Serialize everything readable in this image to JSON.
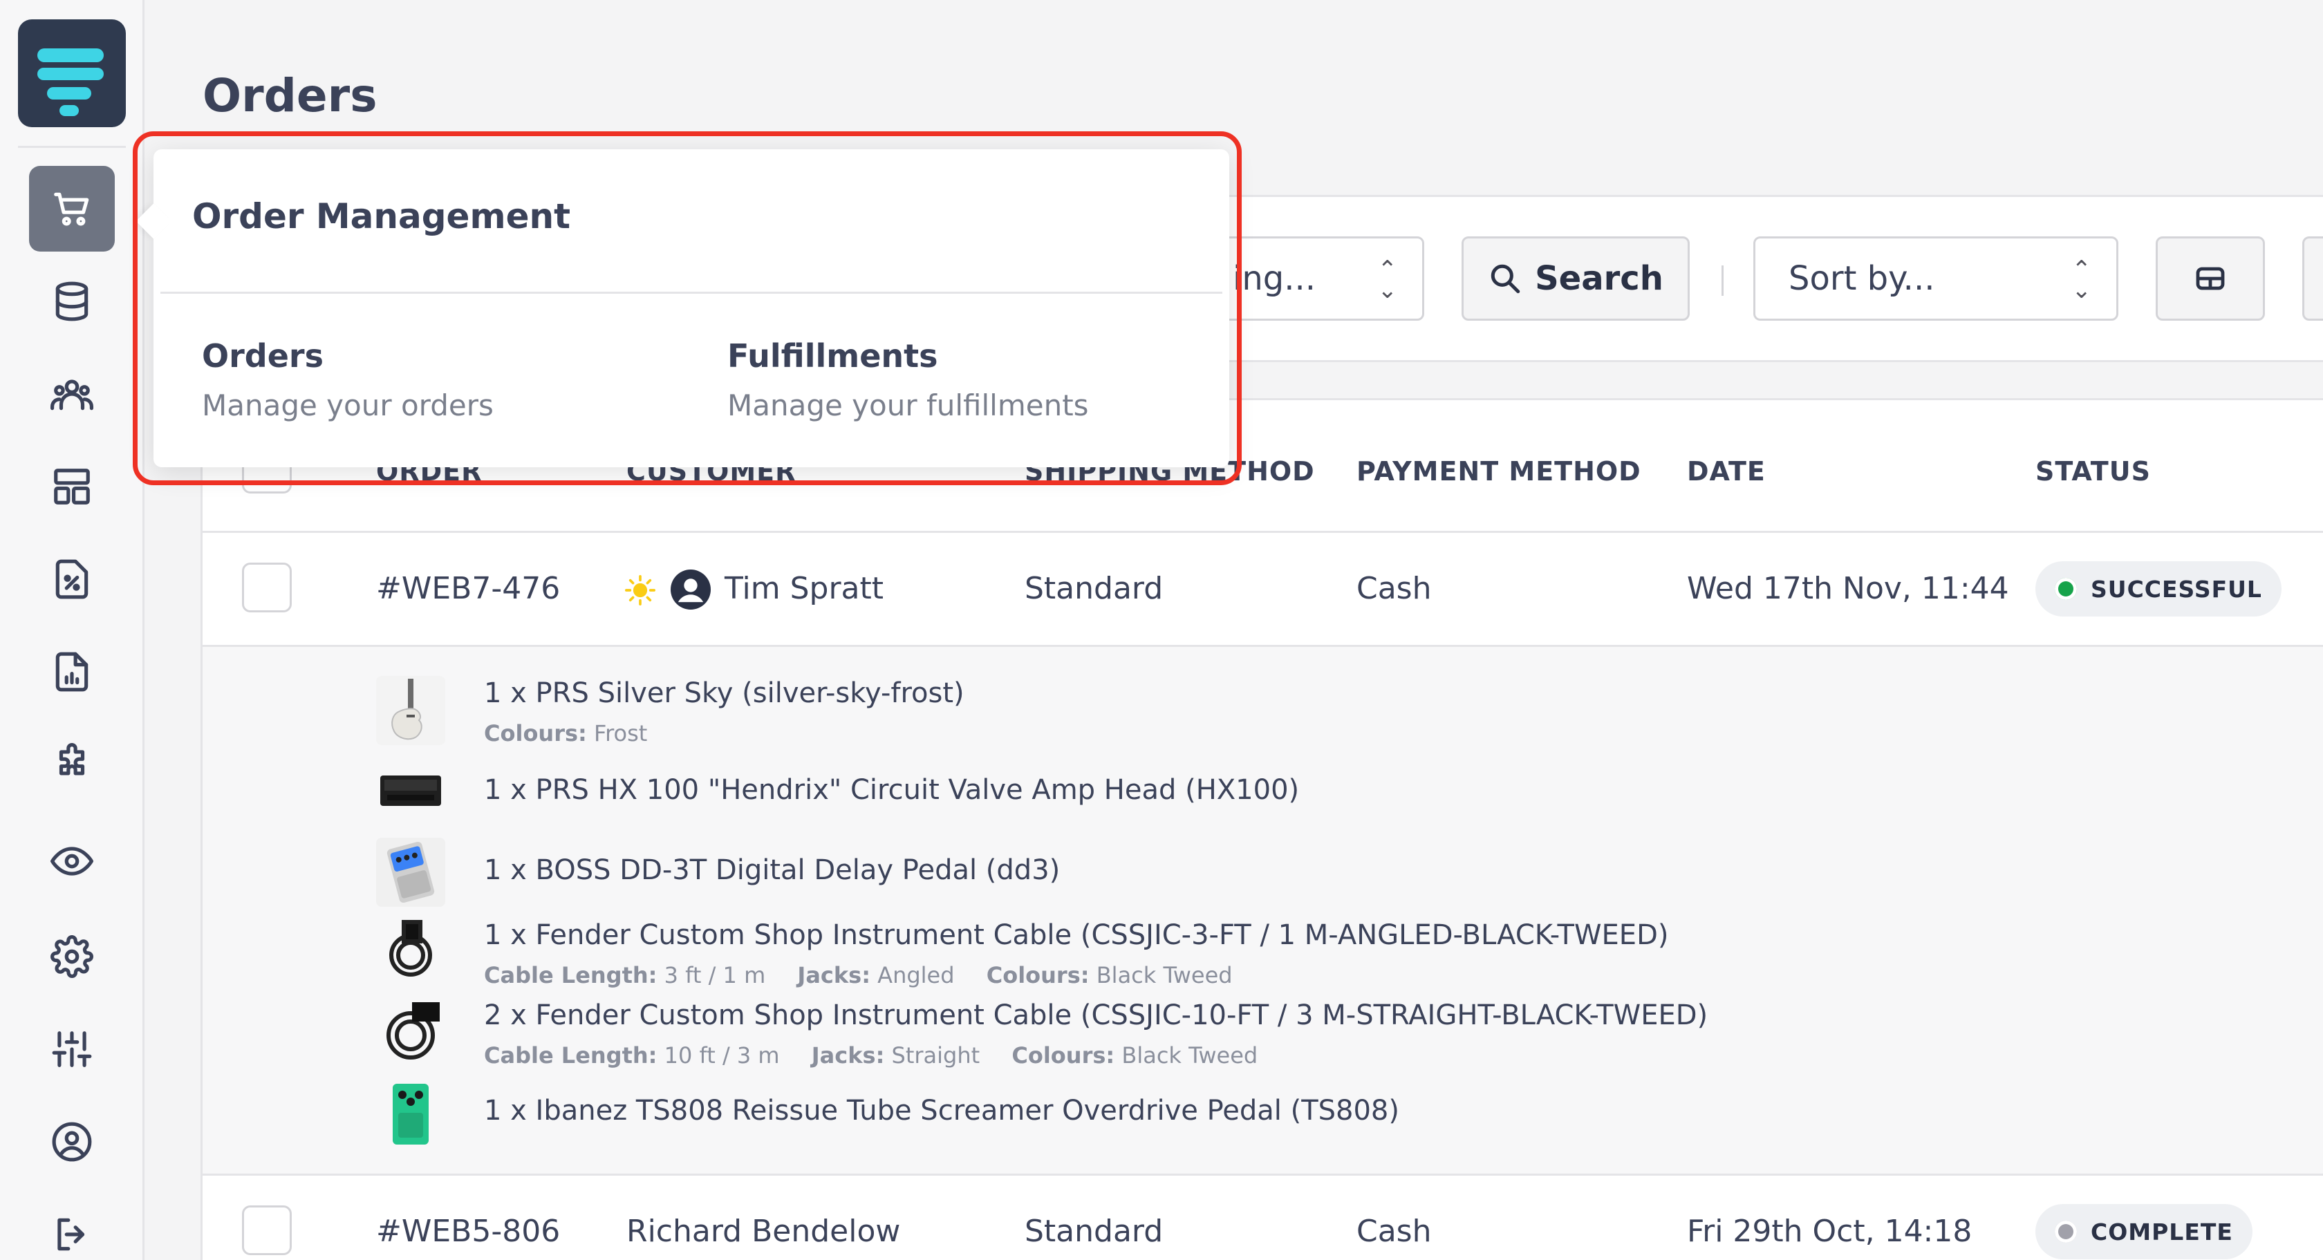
{
  "sidebar": {
    "icons": [
      "cart-icon",
      "database-icon",
      "users-icon",
      "layout-icon",
      "discount-icon",
      "report-icon",
      "puzzle-icon",
      "eye-icon",
      "gear-icon",
      "sliders-icon",
      "user-circle-icon",
      "logout-icon"
    ],
    "active": "cart-icon"
  },
  "page": {
    "title": "Orders"
  },
  "toolbar": {
    "filter_select": "ing...",
    "search_label": "Search",
    "sort_select": "Sort by..."
  },
  "table": {
    "headers": [
      "ORDER",
      "CUSTOMER",
      "SHIPPING METHOD",
      "PAYMENT METHOD",
      "DATE",
      "STATUS"
    ],
    "rows": [
      {
        "order": "#WEB7-476",
        "customer": "Tim Spratt",
        "shipping": "Standard",
        "payment": "Cash",
        "date": "Wed 17th Nov, 11:44",
        "status": "SUCCESSFUL",
        "status_color": "#16a34a",
        "items": [
          {
            "text": "1 x PRS Silver Sky (silver-sky-frost)",
            "meta": [
              {
                "label": "Colours:",
                "value": "Frost"
              }
            ]
          },
          {
            "text": "1 x PRS HX 100 \"Hendrix\" Circuit Valve Amp Head (HX100)",
            "meta": []
          },
          {
            "text": "1 x BOSS DD-3T Digital Delay Pedal (dd3)",
            "meta": []
          },
          {
            "text": "1 x Fender Custom Shop Instrument Cable (CSSJIC-3-FT / 1 M-ANGLED-BLACK-TWEED)",
            "meta": [
              {
                "label": "Cable Length:",
                "value": "3 ft / 1 m"
              },
              {
                "label": "Jacks:",
                "value": "Angled"
              },
              {
                "label": "Colours:",
                "value": "Black Tweed"
              }
            ]
          },
          {
            "text": "2 x Fender Custom Shop Instrument Cable (CSSJIC-10-FT / 3 M-STRAIGHT-BLACK-TWEED)",
            "meta": [
              {
                "label": "Cable Length:",
                "value": "10 ft / 3 m"
              },
              {
                "label": "Jacks:",
                "value": "Straight"
              },
              {
                "label": "Colours:",
                "value": "Black Tweed"
              }
            ]
          },
          {
            "text": "1 x Ibanez TS808 Reissue Tube Screamer Overdrive Pedal (TS808)",
            "meta": []
          }
        ]
      },
      {
        "order": "#WEB5-806",
        "customer": "Richard Bendelow",
        "shipping": "Standard",
        "payment": "Cash",
        "date": "Fri 29th Oct, 14:18",
        "status": "COMPLETE",
        "status_color": "#a1a1aa"
      }
    ]
  },
  "popover": {
    "title": "Order Management",
    "links": [
      {
        "title": "Orders",
        "description": "Manage your orders"
      },
      {
        "title": "Fulfillments",
        "description": "Manage your fulfillments"
      }
    ]
  }
}
